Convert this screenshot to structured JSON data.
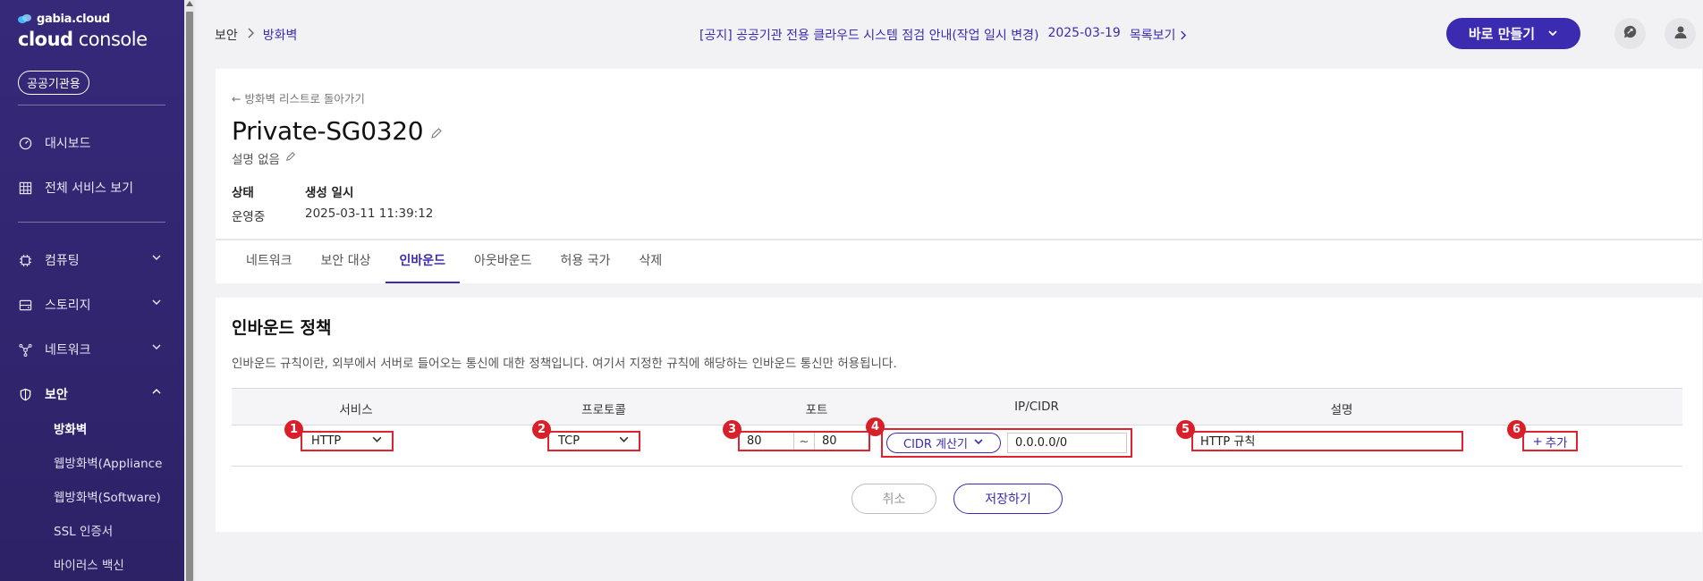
{
  "sidebar": {
    "brand_small": "gabia.cloud",
    "brand_main_bold": "cloud",
    "brand_main_rest": " console",
    "badge": "공공기관용",
    "items": [
      {
        "label": "대시보드"
      },
      {
        "label": "전체 서비스 보기"
      },
      {
        "label": "컴퓨팅"
      },
      {
        "label": "스토리지"
      },
      {
        "label": "네트워크"
      },
      {
        "label": "보안"
      }
    ],
    "sub_items": [
      {
        "label": "방화벽"
      },
      {
        "label": "웹방화벽(Appliance"
      },
      {
        "label": "웹방화벽(Software)"
      },
      {
        "label": "SSL 인증서"
      },
      {
        "label": "바이러스 백신"
      }
    ]
  },
  "header": {
    "breadcrumb_root": "보안",
    "breadcrumb_current": "방화벽",
    "notice_text": "[공지] 공공기관 전용 클라우드 시스템 점검 안내(작업 일시 변경)",
    "notice_date": "2025-03-19",
    "notice_list": "목록보기",
    "create_button": "바로 만들기"
  },
  "detail": {
    "back_link": "방화벽 리스트로 돌아가기",
    "title": "Private-SG0320",
    "description": "설명 없음",
    "status_label": "상태",
    "status_value": "운영중",
    "created_label": "생성 일시",
    "created_value": "2025-03-11 11:39:12",
    "tabs": [
      {
        "label": "네트워크"
      },
      {
        "label": "보안 대상"
      },
      {
        "label": "인바운드"
      },
      {
        "label": "아웃바운드"
      },
      {
        "label": "허용 국가"
      },
      {
        "label": "삭제"
      }
    ]
  },
  "inbound": {
    "title": "인바운드 정책",
    "description": "인바운드 규칙이란, 외부에서 서버로 들어오는 통신에 대한 정책입니다. 여기서 지정한 규칙에 해당하는 인바운드 통신만 허용됩니다.",
    "columns": [
      "서비스",
      "프로토콜",
      "포트",
      "IP/CIDR",
      "설명"
    ],
    "row": {
      "service": "HTTP",
      "protocol": "TCP",
      "port_from": "80",
      "port_sep": "~",
      "port_to": "80",
      "cidr_button": "CIDR 계산기",
      "cidr_value": "0.0.0.0/0",
      "description": "HTTP 규칙",
      "add_label": "추가"
    },
    "markers": [
      "1",
      "2",
      "3",
      "4",
      "5",
      "6"
    ],
    "cancel_button": "취소",
    "save_button": "저장하기"
  },
  "colors": {
    "sidebar_bg": "#36297a",
    "accent": "#3b2bb0",
    "highlight_red": "#e0232e"
  }
}
